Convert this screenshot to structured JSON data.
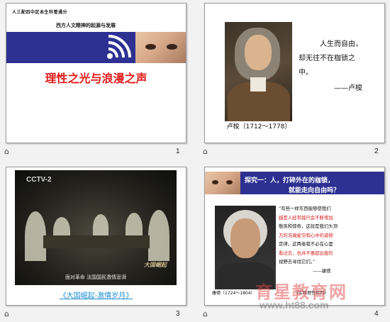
{
  "slides": [
    {
      "number": "1",
      "header_small": "人三配四中区本生科管通分",
      "header_sub": "西方人文精神的起源与发展",
      "title": "理性之光与浪漫之声"
    },
    {
      "number": "2",
      "quote_line1": "人生而自由，",
      "quote_line2": "却无往不在枷锁之",
      "quote_line3": "中。",
      "quote_author": "——卢梭",
      "portrait_caption": "卢梭（1712～1778）"
    },
    {
      "number": "3",
      "channel_logo": "CCTV-2",
      "video_subtitle": "面对革命  法国国民激情澎湃",
      "video_logo": "大国崛起",
      "link_text": "《大国崛起-激情岁月》"
    },
    {
      "number": "4",
      "header_line1": "探究一：人，打碎外在的枷锁，",
      "header_line2": "就能走向自由吗？",
      "body_lines": [
        "“有些一样东西能够使我们",
        "越是人经常越只会不断增加",
        "敬畏和惊奇，这就是我们头顶",
        "方的浩瀚星空和心中的道德",
        "定律。这两者我不必在心里",
        "看过去，也并不要超出我的",
        "视野去寻找它们。”"
      ],
      "body_cite_author": "——康德",
      "body_cite_book": "《实践理性批判》",
      "portrait_caption": "康德（1724～1804）"
    }
  ],
  "watermark": {
    "site_name": "育星教育网",
    "url": "www.ht88.com"
  },
  "colors": {
    "band_blue": "#2e3192",
    "title_red": "#e31a1a",
    "link_blue": "#1e8fd0"
  },
  "icons": [
    "rss-icon",
    "slide-marker-icon"
  ]
}
